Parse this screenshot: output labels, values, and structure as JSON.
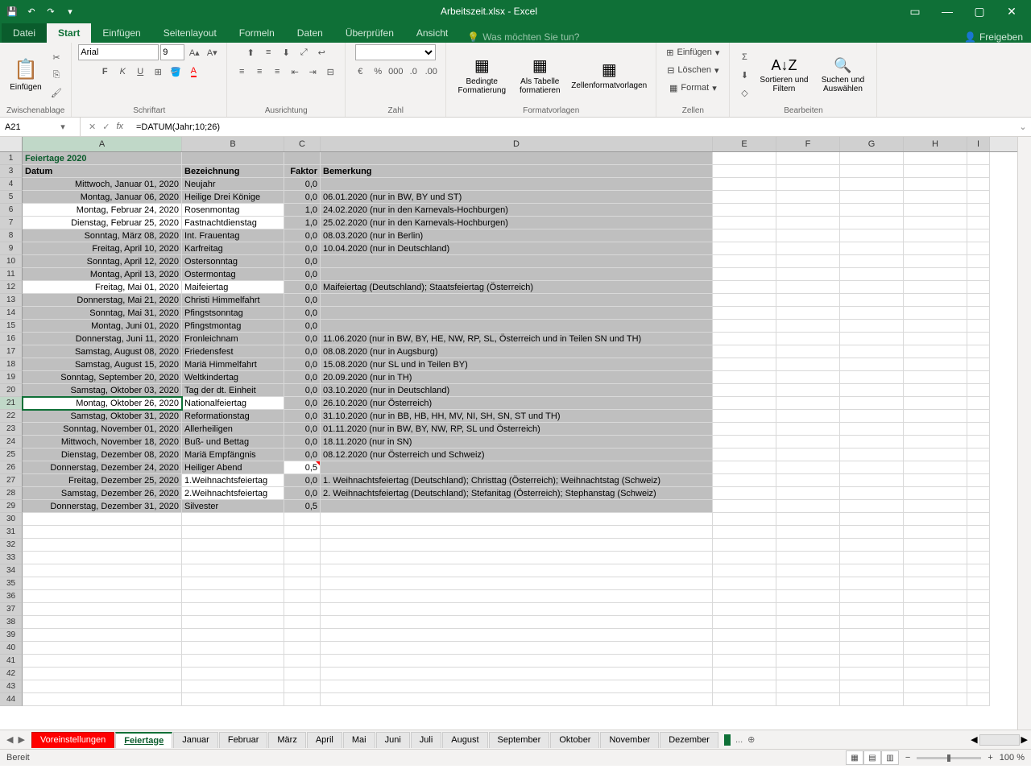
{
  "app": {
    "title": "Arbeitszeit.xlsx - Excel",
    "status": "Bereit",
    "zoom": "100 %",
    "share": "Freigeben",
    "tellme": "Was möchten Sie tun?"
  },
  "tabs": {
    "file": "Datei",
    "start": "Start",
    "einf": "Einfügen",
    "layout": "Seitenlayout",
    "formeln": "Formeln",
    "daten": "Daten",
    "ueber": "Überprüfen",
    "ansicht": "Ansicht"
  },
  "ribbon": {
    "clipboard": "Zwischenablage",
    "paste": "Einfügen",
    "font_group": "Schriftart",
    "font": "Arial",
    "size": "9",
    "align": "Ausrichtung",
    "number": "Zahl",
    "styles": "Formatvorlagen",
    "cond": "Bedingte Formatierung",
    "table": "Als Tabelle formatieren",
    "cellstyle": "Zellenformatvorlagen",
    "cells": "Zellen",
    "insert": "Einfügen",
    "delete": "Löschen",
    "format": "Format",
    "edit": "Bearbeiten",
    "sort": "Sortieren und Filtern",
    "find": "Suchen und Auswählen"
  },
  "namebox": "A21",
  "formula": "=DATUM(Jahr;10;26)",
  "cols": [
    "A",
    "B",
    "C",
    "D",
    "E",
    "F",
    "G",
    "H",
    "I"
  ],
  "header": {
    "title": "Feiertage 2020",
    "datum": "Datum",
    "bez": "Bezeichnung",
    "faktor": "Faktor",
    "bem": "Bemerkung"
  },
  "rows": [
    {
      "r": 4,
      "a": "Mittwoch, Januar 01, 2020",
      "b": "Neujahr",
      "c": "0,0",
      "d": "",
      "ga": true,
      "gd": true
    },
    {
      "r": 5,
      "a": "Montag, Januar 06, 2020",
      "b": "Heilige Drei Könige",
      "c": "0,0",
      "d": "06.01.2020 (nur in BW, BY und ST)",
      "ga": true,
      "gd": true
    },
    {
      "r": 6,
      "a": "Montag, Februar 24, 2020",
      "b": "Rosenmontag",
      "c": "1,0",
      "d": "24.02.2020 (nur in den Karnevals-Hochburgen)",
      "ga": false,
      "gd": true
    },
    {
      "r": 7,
      "a": "Dienstag, Februar 25, 2020",
      "b": "Fastnachtdienstag",
      "c": "1,0",
      "d": "25.02.2020 (nur in den Karnevals-Hochburgen)",
      "ga": false,
      "gd": true
    },
    {
      "r": 8,
      "a": "Sonntag, März 08, 2020",
      "b": "Int. Frauentag",
      "c": "0,0",
      "d": "08.03.2020 (nur in Berlin)",
      "ga": true,
      "gd": true
    },
    {
      "r": 9,
      "a": "Freitag, April 10, 2020",
      "b": "Karfreitag",
      "c": "0,0",
      "d": "10.04.2020 (nur in Deutschland)",
      "ga": true,
      "gd": true
    },
    {
      "r": 10,
      "a": "Sonntag, April 12, 2020",
      "b": "Ostersonntag",
      "c": "0,0",
      "d": "",
      "ga": true,
      "gd": true
    },
    {
      "r": 11,
      "a": "Montag, April 13, 2020",
      "b": "Ostermontag",
      "c": "0,0",
      "d": "",
      "ga": true,
      "gd": true
    },
    {
      "r": 12,
      "a": "Freitag, Mai 01, 2020",
      "b": "Maifeiertag",
      "c": "0,0",
      "d": "Maifeiertag (Deutschland); Staatsfeiertag (Österreich)",
      "ga": false,
      "gd": true
    },
    {
      "r": 13,
      "a": "Donnerstag, Mai 21, 2020",
      "b": "Christi Himmelfahrt",
      "c": "0,0",
      "d": "",
      "ga": true,
      "gd": true
    },
    {
      "r": 14,
      "a": "Sonntag, Mai 31, 2020",
      "b": "Pfingstsonntag",
      "c": "0,0",
      "d": "",
      "ga": true,
      "gd": true
    },
    {
      "r": 15,
      "a": "Montag, Juni 01, 2020",
      "b": "Pfingstmontag",
      "c": "0,0",
      "d": "",
      "ga": true,
      "gd": true
    },
    {
      "r": 16,
      "a": "Donnerstag, Juni 11, 2020",
      "b": "Fronleichnam",
      "c": "0,0",
      "d": "11.06.2020 (nur in BW, BY, HE, NW, RP, SL, Österreich und in Teilen SN und TH)",
      "ga": true,
      "gd": true
    },
    {
      "r": 17,
      "a": "Samstag, August 08, 2020",
      "b": "Friedensfest",
      "c": "0,0",
      "d": "08.08.2020 (nur in Augsburg)",
      "ga": true,
      "gd": true
    },
    {
      "r": 18,
      "a": "Samstag, August 15, 2020",
      "b": "Mariä Himmelfahrt",
      "c": "0,0",
      "d": "15.08.2020 (nur SL und in Teilen BY)",
      "ga": true,
      "gd": true
    },
    {
      "r": 19,
      "a": "Sonntag, September 20, 2020",
      "b": "Weltkindertag",
      "c": "0,0",
      "d": "20.09.2020 (nur in TH)",
      "ga": true,
      "gd": true
    },
    {
      "r": 20,
      "a": "Samstag, Oktober 03, 2020",
      "b": "Tag der dt. Einheit",
      "c": "0,0",
      "d": "03.10.2020 (nur in Deutschland)",
      "ga": true,
      "gd": true
    },
    {
      "r": 21,
      "a": "Montag, Oktober 26, 2020",
      "b": "Nationalfeiertag",
      "c": "0,0",
      "d": "26.10.2020 (nur Österreich)",
      "ga": false,
      "gd": true,
      "active": true
    },
    {
      "r": 22,
      "a": "Samstag, Oktober 31, 2020",
      "b": "Reformationstag",
      "c": "0,0",
      "d": "31.10.2020 (nur in BB, HB, HH, MV, NI, SH, SN, ST und TH)",
      "ga": true,
      "gd": true
    },
    {
      "r": 23,
      "a": "Sonntag, November 01, 2020",
      "b": "Allerheiligen",
      "c": "0,0",
      "d": "01.11.2020 (nur in BW, BY, NW, RP, SL und Österreich)",
      "ga": true,
      "gd": true
    },
    {
      "r": 24,
      "a": "Mittwoch, November 18, 2020",
      "b": "Buß- und Bettag",
      "c": "0,0",
      "d": "18.11.2020 (nur in SN)",
      "ga": true,
      "gd": true
    },
    {
      "r": 25,
      "a": "Dienstag, Dezember 08, 2020",
      "b": "Mariä Empfängnis",
      "c": "0,0",
      "d": "08.12.2020 (nur Österreich und Schweiz)",
      "ga": true,
      "gd": true
    },
    {
      "r": 26,
      "a": "Donnerstag, Dezember 24, 2020",
      "b": "Heiliger Abend",
      "c": "0,5",
      "d": "",
      "ga": true,
      "gd": true,
      "gc": false,
      "red": true
    },
    {
      "r": 27,
      "a": "Freitag, Dezember 25, 2020",
      "b": "1.Weihnachtsfeiertag",
      "c": "0,0",
      "d": "1. Weihnachtsfeiertag (Deutschland); Christtag (Österreich); Weihnachtstag (Schweiz)",
      "ga": true,
      "gd": true,
      "gb": false
    },
    {
      "r": 28,
      "a": "Samstag, Dezember 26, 2020",
      "b": "2.Weihnachtsfeiertag",
      "c": "0,0",
      "d": "2. Weihnachtsfeiertag (Deutschland); Stefanitag (Österreich); Stephanstag (Schweiz)",
      "ga": true,
      "gd": true,
      "gb": false
    },
    {
      "r": 29,
      "a": "Donnerstag, Dezember 31, 2020",
      "b": "Silvester",
      "c": "0,5",
      "d": "",
      "ga": true,
      "gd": true
    }
  ],
  "sheets": [
    "Voreinstellungen",
    "Feiertage",
    "Januar",
    "Februar",
    "März",
    "April",
    "Mai",
    "Juni",
    "Juli",
    "August",
    "September",
    "Oktober",
    "November",
    "Dezember"
  ]
}
